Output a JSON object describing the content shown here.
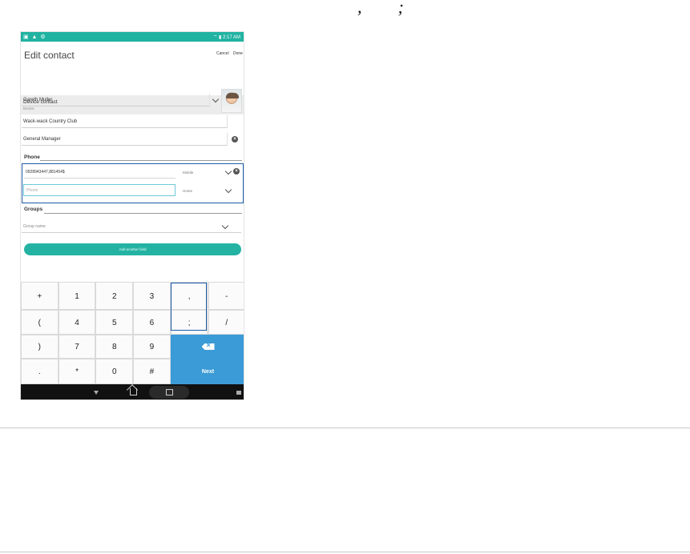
{
  "caption": {
    "comma": ",",
    "semicolon": ";"
  },
  "statusbar": {
    "left_icons": "▣ ▲ ⚙",
    "right_text": "⌔ ▮ 2:17 AM"
  },
  "header": {
    "title": "Edit contact",
    "cancel_label": "Cancel",
    "done_label": "Done"
  },
  "account": {
    "title": "Device contact",
    "subtitle": "Device"
  },
  "fields": {
    "name": "Gareth Muller",
    "company": "Wack-wack Country Club",
    "job_title": "General Manager"
  },
  "phone_section": {
    "label": "Phone",
    "entries": [
      {
        "number": "0928943447,881454$",
        "type": "Mobile",
        "placeholder": ""
      },
      {
        "number": "",
        "type": "Home",
        "placeholder": "Phone"
      }
    ]
  },
  "groups_section": {
    "label": "Groups",
    "placeholder": "Group name"
  },
  "add_field_label": "Add another field",
  "keypad": {
    "rows": [
      [
        "+",
        "1",
        "2",
        "3",
        ",",
        "-"
      ],
      [
        "(",
        "4",
        "5",
        "6",
        ";",
        "/"
      ],
      [
        ")",
        "7",
        "8",
        "9"
      ],
      [
        ".",
        "*",
        "0",
        "#"
      ]
    ],
    "next_label": "Next"
  },
  "colors": {
    "accent": "#24b3a3",
    "highlight": "#1d5aa8",
    "key_blue": "#3b9bd6"
  }
}
